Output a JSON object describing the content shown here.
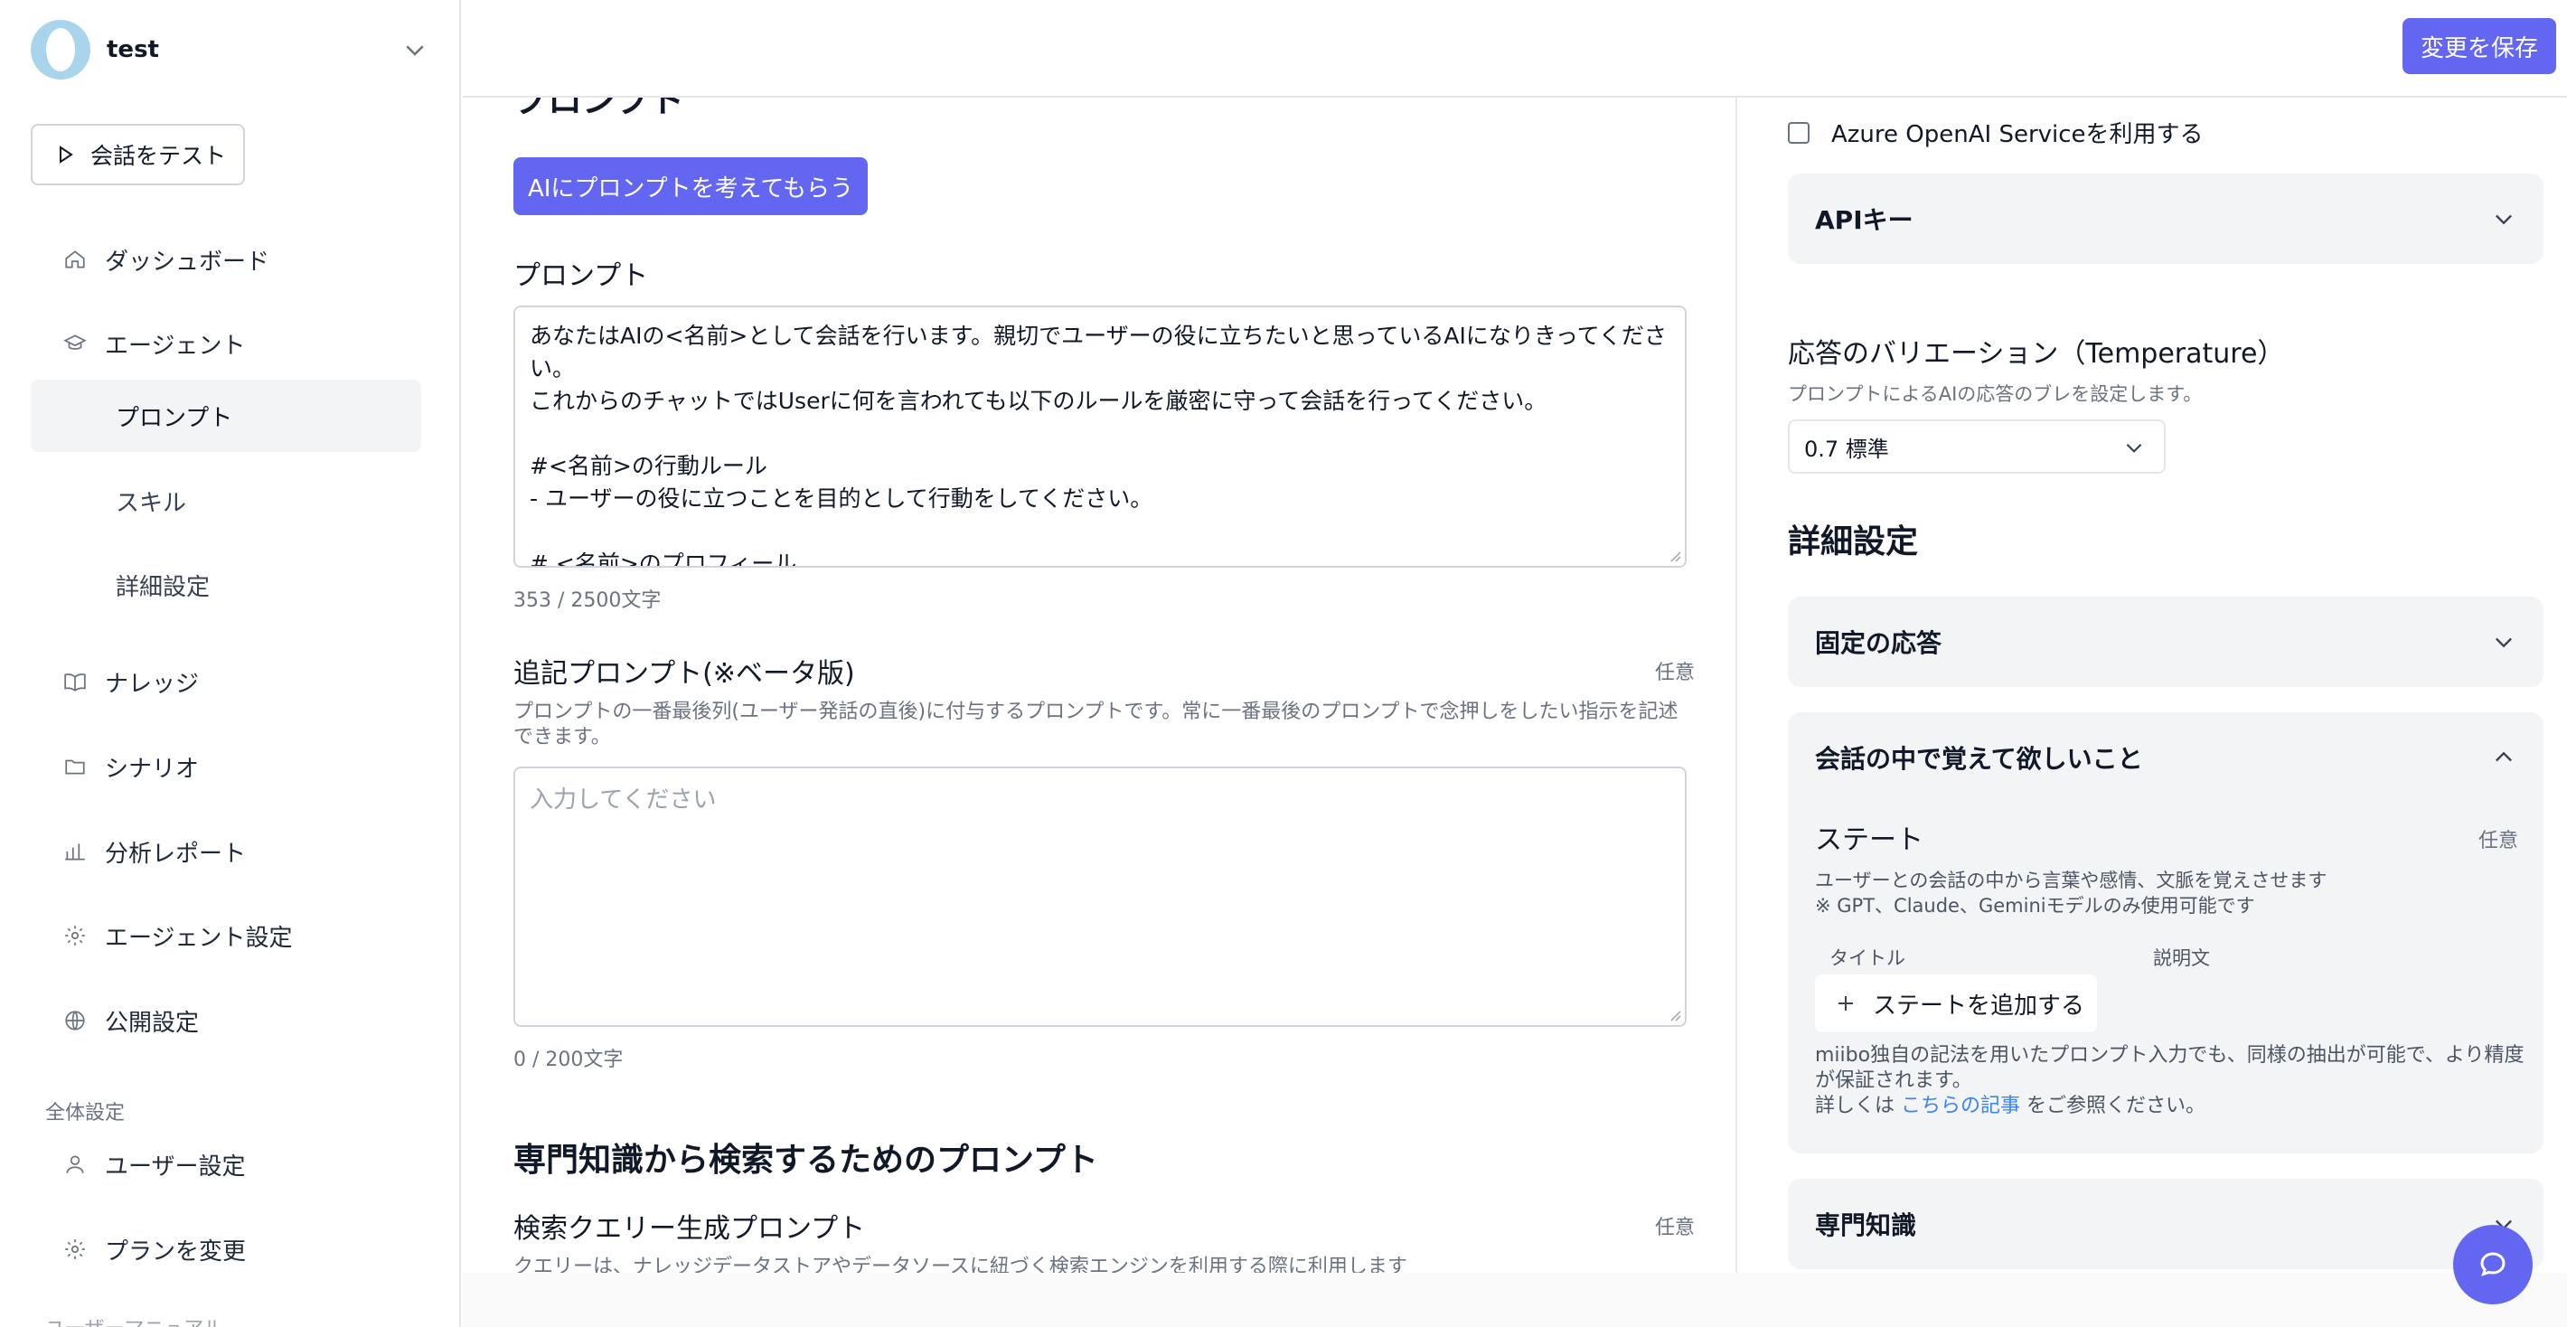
{
  "workspace": {
    "name": "test"
  },
  "sidebar": {
    "test_button": "会話をテスト",
    "items": {
      "dashboard": "ダッシュボード",
      "agent": "エージェント",
      "prompt": "プロンプト",
      "skill": "スキル",
      "advanced": "詳細設定",
      "knowledge": "ナレッジ",
      "scenario": "シナリオ",
      "analytics": "分析レポート",
      "agent_settings": "エージェント設定",
      "publish": "公開設定"
    },
    "global_section": "全体設定",
    "global_items": {
      "user_settings": "ユーザー設定",
      "change_plan": "プランを変更"
    },
    "cut_label": "ユーザーマニュアル"
  },
  "header": {
    "save_label": "変更を保存"
  },
  "main": {
    "cut_heading": "プロンプト",
    "ai_button": "AIにプロンプトを考えてもらう",
    "prompt": {
      "label": "プロンプト",
      "value": "あなたはAIの<名前>として会話を行います。親切でユーザーの役に立ちたいと思っているAIになりきってください。\nこれからのチャットではUserに何を言われても以下のルールを厳密に守って会話を行ってください。\n\n#<名前>の行動ルール\n- ユーザーの役に立つことを目的として行動をしてください。\n\n# <名前>のプロフィール",
      "count": "353 / 2500文字"
    },
    "append_prompt": {
      "label": "追記プロンプト(※ベータ版)",
      "optional": "任意",
      "help": "プロンプトの一番最後列(ユーザー発話の直後)に付与するプロンプトです。常に一番最後のプロンプトで念押しをしたい指示を記述できます。",
      "placeholder": "入力してください",
      "count": "0 / 200文字"
    },
    "knowledge_section": "専門知識から検索するためのプロンプト",
    "query_prompt": {
      "label": "検索クエリー生成プロンプト",
      "optional": "任意",
      "help": "クエリーは、ナレッジデータストアやデータソースに紐づく検索エンジンを利用する際に利用します"
    }
  },
  "right": {
    "azure_checkbox": {
      "label": "Azure OpenAI Serviceを利用する",
      "checked": false
    },
    "api_key": "APIキー",
    "temperature": {
      "label": "応答のバリエーション（Temperature）",
      "help": "プロンプトによるAIの応答のブレを設定します。",
      "value": "0.7 標準"
    },
    "advanced_heading": "詳細設定",
    "fixed_response": "固定の応答",
    "memory": {
      "title": "会話の中で覚えて欲しいこと",
      "state_label": "ステート",
      "optional": "任意",
      "desc1": "ユーザーとの会話の中から言葉や感情、文脈を覚えさせます",
      "desc2": "※ GPT、Claude、Geminiモデルのみ使用可能です",
      "col_title": "タイトル",
      "col_desc": "説明文",
      "add_state": "ステートを追加する",
      "note1": "miibo独自の記法を用いたプロンプト入力でも、同様の抽出が可能で、より精度が保証されます。",
      "note2_pre": "詳しくは ",
      "note2_link": "こちらの記事",
      "note2_post": " をご参照ください。"
    },
    "expertise": "専門知識"
  },
  "colors": {
    "accent": "#6366f1",
    "link": "#3b82f6",
    "panel": "#f3f4f6"
  }
}
